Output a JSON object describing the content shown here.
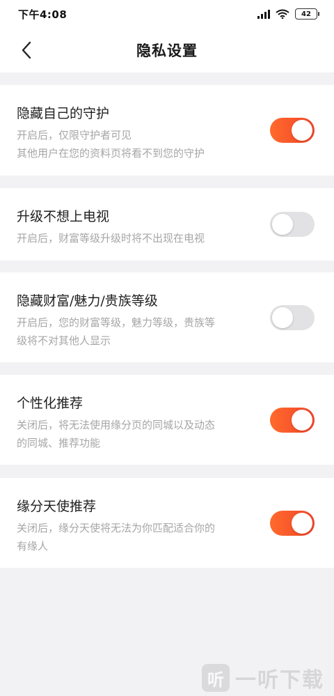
{
  "status_bar": {
    "time": "下午4:08",
    "battery": "42"
  },
  "nav": {
    "title": "隐私设置",
    "back_icon": "chevron-left-icon"
  },
  "colors": {
    "accent_on": "#f2452a",
    "toggle_off": "#e2e2e4",
    "background": "#f2f2f4"
  },
  "settings": [
    {
      "title": "隐藏自己的守护",
      "desc_lines": [
        "开启后，仅限守护者可见",
        "其他用户在您的资料页将看不到您的守护"
      ],
      "enabled": true
    },
    {
      "title": "升级不想上电视",
      "desc_lines": [
        "开启后，财富等级升级时将不出现在电视"
      ],
      "enabled": false
    },
    {
      "title": "隐藏财富/魅力/贵族等级",
      "desc_lines": [
        "开启后，您的财富等级，魅力等级，贵族等",
        "级将不对其他人显示"
      ],
      "enabled": false
    },
    {
      "title": "个性化推荐",
      "desc_lines": [
        "关闭后，将无法使用缘分页的同城以及动态",
        "的同城、推荐功能"
      ],
      "enabled": true
    },
    {
      "title": "缘分天使推荐",
      "desc_lines": [
        "关闭后，缘分天使将无法为你匹配适合你的",
        "有缘人"
      ],
      "enabled": true
    }
  ],
  "watermark": {
    "logo_char": "听",
    "text": "一听下载"
  }
}
